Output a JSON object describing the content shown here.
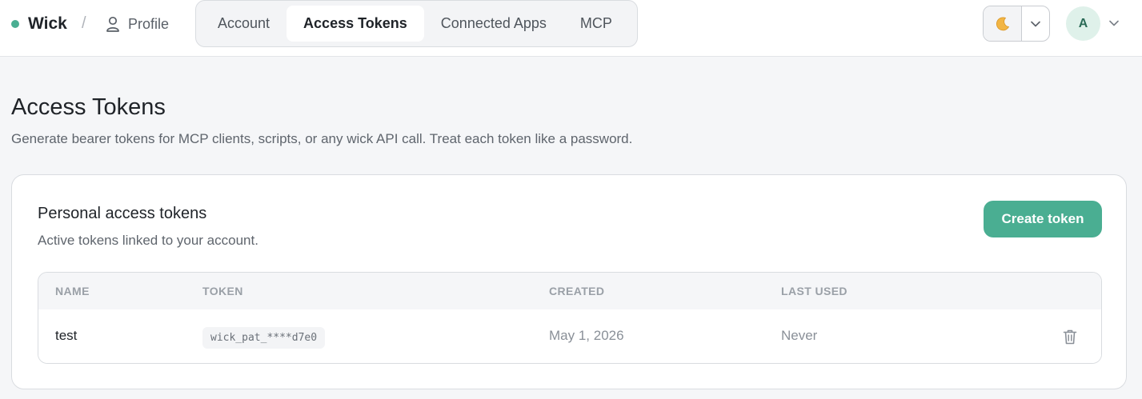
{
  "colors": {
    "accent": "#4aae92",
    "brand_dot": "#4aae92"
  },
  "header": {
    "brand": "Wick",
    "separator": "/",
    "profile_label": "Profile",
    "profile_icon": "user-icon",
    "tabs": [
      {
        "label": "Account",
        "active": false
      },
      {
        "label": "Access Tokens",
        "active": true
      },
      {
        "label": "Connected Apps",
        "active": false
      },
      {
        "label": "MCP",
        "active": false
      }
    ],
    "theme_icon": "moon-icon",
    "avatar_initial": "A"
  },
  "page": {
    "title": "Access Tokens",
    "subtitle": "Generate bearer tokens for MCP clients, scripts, or any wick API call. Treat each token like a password."
  },
  "card": {
    "title": "Personal access tokens",
    "subtitle": "Active tokens linked to your account.",
    "create_label": "Create token",
    "columns": [
      "NAME",
      "TOKEN",
      "CREATED",
      "LAST USED"
    ],
    "rows": [
      {
        "name": "test",
        "token": "wick_pat_****d7e0",
        "created": "May 1, 2026",
        "last_used": "Never"
      }
    ]
  }
}
